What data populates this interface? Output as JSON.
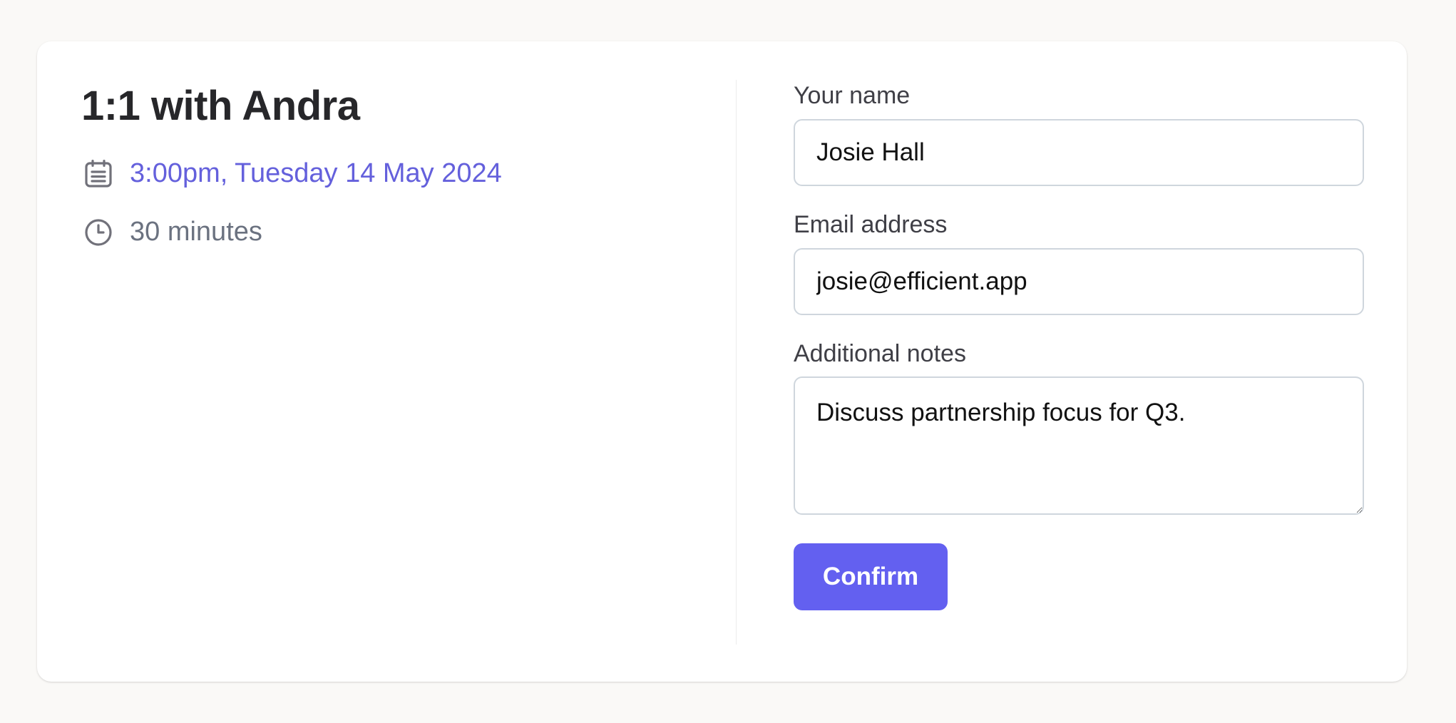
{
  "event": {
    "title": "1:1 with Andra",
    "datetime": "3:00pm, Tuesday 14 May 2024",
    "duration": "30 minutes"
  },
  "icons": {
    "date": "calendar-icon",
    "duration": "clock-icon"
  },
  "form": {
    "name": {
      "label": "Your name",
      "value": "Josie Hall"
    },
    "email": {
      "label": "Email address",
      "value": "josie@efficient.app"
    },
    "notes": {
      "label": "Additional notes",
      "value": "Discuss partnership focus for Q3."
    },
    "confirm_label": "Confirm"
  },
  "colors": {
    "accent": "#6360f0",
    "date_text": "#6460dc",
    "muted_text": "#6b7280",
    "background": "#faf9f7",
    "card": "#ffffff"
  }
}
